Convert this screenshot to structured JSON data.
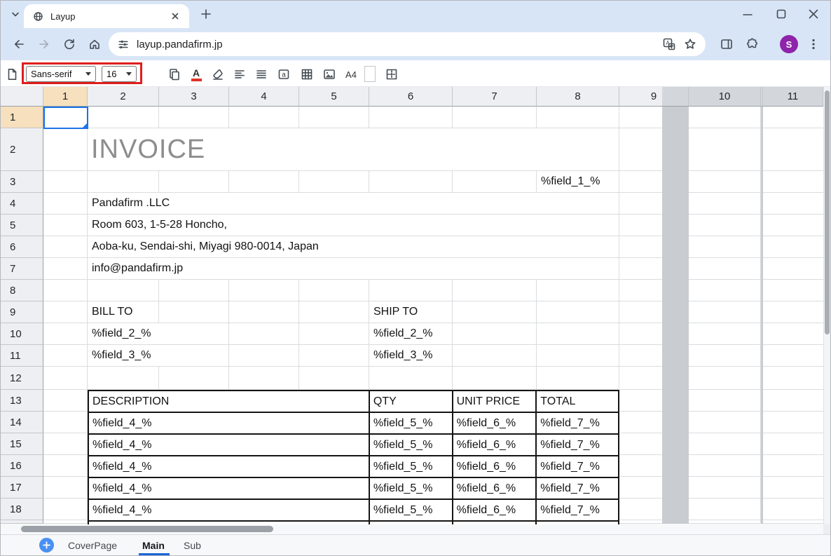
{
  "browser": {
    "tab_title": "Layup",
    "url": "layup.pandafirm.jp",
    "profile_initial": "S"
  },
  "toolbar": {
    "font_family": "Sans-serif",
    "font_size": "16",
    "paper_size": "A4",
    "text_color_glyph": "A",
    "cell_glyph": "a"
  },
  "grid": {
    "columns": [
      "1",
      "2",
      "3",
      "4",
      "5",
      "6",
      "7",
      "8",
      "9",
      "10",
      "11"
    ],
    "rows": [
      "1",
      "2",
      "3",
      "4",
      "5",
      "6",
      "7",
      "8",
      "9",
      "10",
      "11",
      "12",
      "13",
      "14",
      "15",
      "16",
      "17",
      "18"
    ]
  },
  "sheet": {
    "title": "INVOICE",
    "field_1": "%field_1_%",
    "company_lines": [
      "Pandafirm .LLC",
      "Room 603, 1-5-28 Honcho,",
      "Aoba-ku, Sendai-shi, Miyagi 980-0014, Japan",
      "info@pandafirm.jp"
    ],
    "bill": {
      "label": "BILL TO",
      "fields": [
        "%field_2_%",
        "%field_3_%"
      ]
    },
    "ship": {
      "label": "SHIP TO",
      "fields": [
        "%field_2_%",
        "%field_3_%"
      ]
    },
    "table": {
      "headers": [
        "DESCRIPTION",
        "QTY",
        "UNIT PRICE",
        "TOTAL"
      ],
      "rows": [
        [
          "%field_4_%",
          "%field_5_%",
          "%field_6_%",
          "%field_7_%"
        ],
        [
          "%field_4_%",
          "%field_5_%",
          "%field_6_%",
          "%field_7_%"
        ],
        [
          "%field_4_%",
          "%field_5_%",
          "%field_6_%",
          "%field_7_%"
        ],
        [
          "%field_4_%",
          "%field_5_%",
          "%field_6_%",
          "%field_7_%"
        ],
        [
          "%field_4_%",
          "%field_5_%",
          "%field_6_%",
          "%field_7_%"
        ]
      ]
    }
  },
  "sheet_tabs": {
    "items": [
      {
        "label": "CoverPage"
      },
      {
        "label": "Main",
        "active": true
      },
      {
        "label": "Sub"
      }
    ]
  }
}
